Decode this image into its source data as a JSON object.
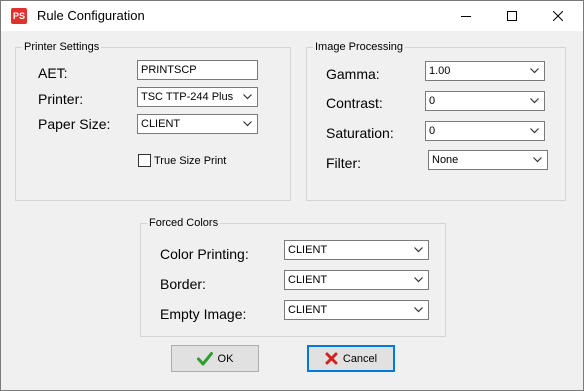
{
  "window": {
    "title": "Rule Configuration",
    "icon_text": "PS",
    "icon_color": "#e0312d"
  },
  "printer_settings": {
    "legend": "Printer Settings",
    "aet_label": "AET:",
    "aet_value": "PRINTSCP",
    "printer_label": "Printer:",
    "printer_value": "TSC TTP-244 Plus",
    "paper_size_label": "Paper Size:",
    "paper_size_value": "CLIENT",
    "true_size_label": "True Size Print",
    "true_size_checked": false
  },
  "image_processing": {
    "legend": "Image Processing",
    "gamma_label": "Gamma:",
    "gamma_value": "1.00",
    "contrast_label": "Contrast:",
    "contrast_value": "0",
    "saturation_label": "Saturation:",
    "saturation_value": "0",
    "filter_label": "Filter:",
    "filter_value": "None"
  },
  "forced_colors": {
    "legend": "Forced Colors",
    "color_printing_label": "Color Printing:",
    "color_printing_value": "CLIENT",
    "border_label": "Border:",
    "border_value": "CLIENT",
    "empty_image_label": "Empty Image:",
    "empty_image_value": "CLIENT"
  },
  "buttons": {
    "ok_label": "OK",
    "cancel_label": "Cancel",
    "ok_icon_color": "#2e9e2e",
    "cancel_icon_color": "#d42020"
  }
}
